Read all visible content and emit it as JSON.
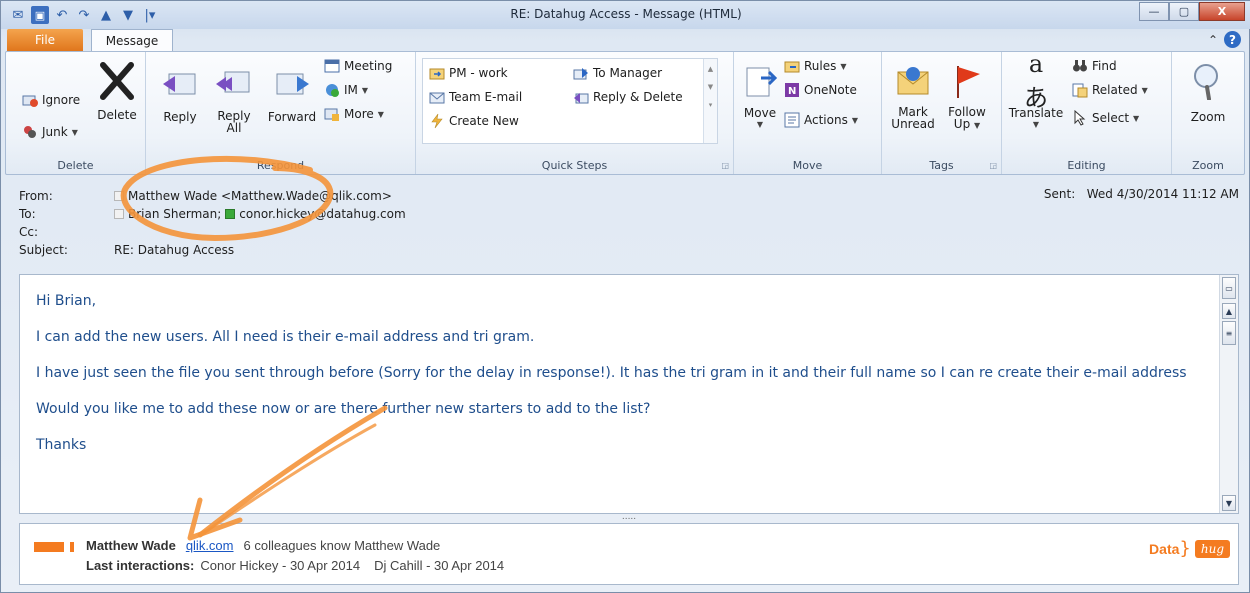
{
  "window": {
    "title": "RE: Datahug Access  -  Message (HTML)",
    "controls": {
      "minimize": "—",
      "maximize": "▢",
      "close": "X"
    }
  },
  "tabs": {
    "file": "File",
    "message": "Message"
  },
  "ribbon": {
    "delete_group": {
      "label": "Delete",
      "ignore": "Ignore",
      "junk": "Junk",
      "delete": "Delete"
    },
    "respond_group": {
      "label": "Respond",
      "reply": "Reply",
      "reply_all_1": "Reply",
      "reply_all_2": "All",
      "forward": "Forward",
      "meeting": "Meeting",
      "im": "IM",
      "more": "More"
    },
    "quick_steps": {
      "label": "Quick Steps",
      "pm_work": "PM - work",
      "team_email": "Team E-mail",
      "create_new": "Create New",
      "to_manager": "To Manager",
      "reply_delete": "Reply & Delete"
    },
    "move_group": {
      "label": "Move",
      "move": "Move",
      "rules": "Rules",
      "onenote": "OneNote",
      "actions": "Actions"
    },
    "tags_group": {
      "label": "Tags",
      "mark_unread_1": "Mark",
      "mark_unread_2": "Unread",
      "follow_up_1": "Follow",
      "follow_up_2": "Up"
    },
    "editing_group": {
      "label": "Editing",
      "translate": "Translate",
      "find": "Find",
      "related": "Related",
      "select": "Select"
    },
    "zoom_group": {
      "label": "Zoom",
      "zoom": "Zoom"
    }
  },
  "header": {
    "from_label": "From:",
    "from_value": "Matthew Wade <Matthew.Wade@qlik.com>",
    "to_label": "To:",
    "to_value_1": "Brian Sherman;",
    "to_value_2": "conor.hickey@datahug.com",
    "cc_label": "Cc:",
    "subject_label": "Subject:",
    "subject_value": "RE: Datahug Access",
    "sent_label": "Sent:",
    "sent_value": "Wed 4/30/2014 11:12 AM"
  },
  "body": {
    "greeting": "Hi Brian,",
    "p1": "I can add the new users. All I need is their e-mail address and tri gram.",
    "p2": "I have just seen the file you sent through before (Sorry for the delay in response!). It has the tri gram in it and their full name so I can re create their e-mail address",
    "p3": "Would you like me to add these now or are there further new starters to add to the list?",
    "closing": "Thanks"
  },
  "social": {
    "name": "Matthew Wade",
    "domain": "qlik.com",
    "colleagues": "6 colleagues know Matthew Wade",
    "last_label": "Last interactions:",
    "int1": "Conor Hickey  -  30 Apr 2014",
    "int2": "Dj Cahill  -  30 Apr 2014",
    "logo_data": "Data",
    "logo_hug": "hug"
  },
  "colors": {
    "accent_orange": "#f47b20",
    "body_text": "#1f4e8c",
    "link": "#1a57c4"
  }
}
